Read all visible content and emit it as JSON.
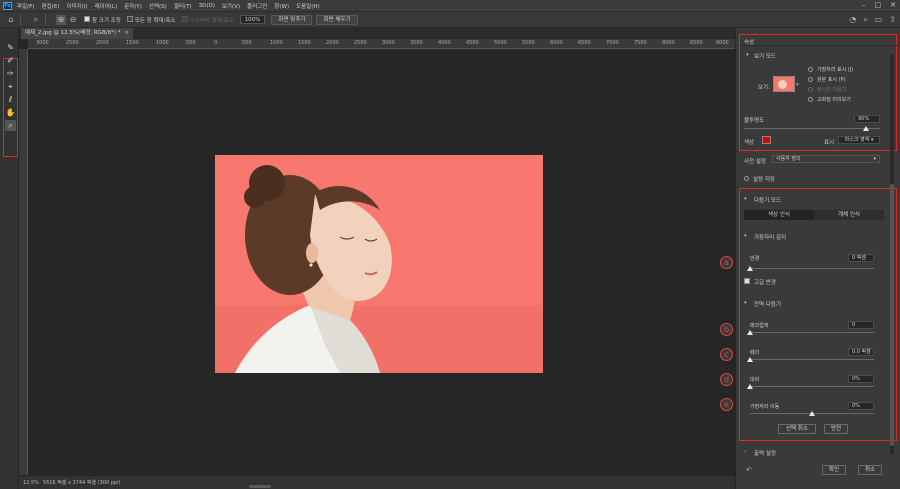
{
  "menubar": {
    "items": [
      "파일(F)",
      "편집(E)",
      "이미지(I)",
      "레이어(L)",
      "문자(Y)",
      "선택(S)",
      "필터(T)",
      "3D(D)",
      "보기(V)",
      "플러그인",
      "창(W)",
      "도움말(H)"
    ]
  },
  "options": {
    "resize_windows": "창 크기 조정",
    "zoom_all": "모든 창 확대/축소",
    "scrubby_zoom": "스크러비 확대/축소",
    "zoom_value": "100%",
    "fit_screen": "화면 맞추기",
    "fill_screen": "화면 채우기"
  },
  "document": {
    "tab_title": "예제_2.jpg @ 12.5%(배경, RGB/8*) *",
    "ruler_ticks": [
      "0",
      "3000",
      "2500",
      "2000",
      "1500",
      "1000",
      "500",
      "0",
      "500",
      "1000",
      "1500",
      "2000",
      "2500",
      "3000",
      "3500",
      "4000",
      "4500",
      "5000",
      "5500",
      "6000",
      "6500",
      "7000",
      "7500",
      "8000",
      "8500",
      "9000",
      "9500"
    ],
    "zoom_status": "12.5%",
    "dimensions_status": "5616 픽셀 x 3744 픽셀 (300 ppi)"
  },
  "panel": {
    "tab": "속성",
    "view_mode": {
      "header": "보기 모드",
      "view_label": "보기:",
      "options": [
        "가장자리 표시 (J)",
        "원본 표시 (P)",
        "실시간 다듬기",
        "고화질 미리보기"
      ]
    },
    "opacity": {
      "label": "불투명도",
      "value": "90%",
      "fraction": 0.9
    },
    "color": {
      "label": "색상",
      "swatch": "#e00000",
      "show_label": "표시",
      "show_value": "마스크 영역"
    },
    "preset": {
      "label": "사전 설정",
      "value": "사용자 정의"
    },
    "remember": "설정 저장",
    "refine_mode": {
      "header": "다듬기 모드",
      "color_aware": "색상 인식",
      "object_aware": "개체 인식"
    },
    "edge_detection": {
      "header": "가장자리 감지",
      "radius_label": "반경",
      "radius_value": "0 픽셀",
      "smart_radius": "고급 반경"
    },
    "global_refinements": {
      "header": "전역 다듬기",
      "smooth_label": "매끄럽게",
      "smooth_value": "0",
      "feather_label": "페더",
      "feather_value": "0.0 픽셀",
      "contrast_label": "대비",
      "contrast_value": "0%",
      "shift_edge_label": "가장자리 이동",
      "shift_edge_value": "0%",
      "shift_edge_fraction": 0.5,
      "clear_selection": "선택 취소",
      "invert": "반전"
    },
    "output_settings": "출력 설정",
    "ok": "확인",
    "cancel": "취소",
    "markers": [
      "a",
      "b",
      "c",
      "d",
      "e"
    ]
  },
  "colors": {
    "highlight": "#e02a2a",
    "canvas_bg": "#f8776f"
  }
}
